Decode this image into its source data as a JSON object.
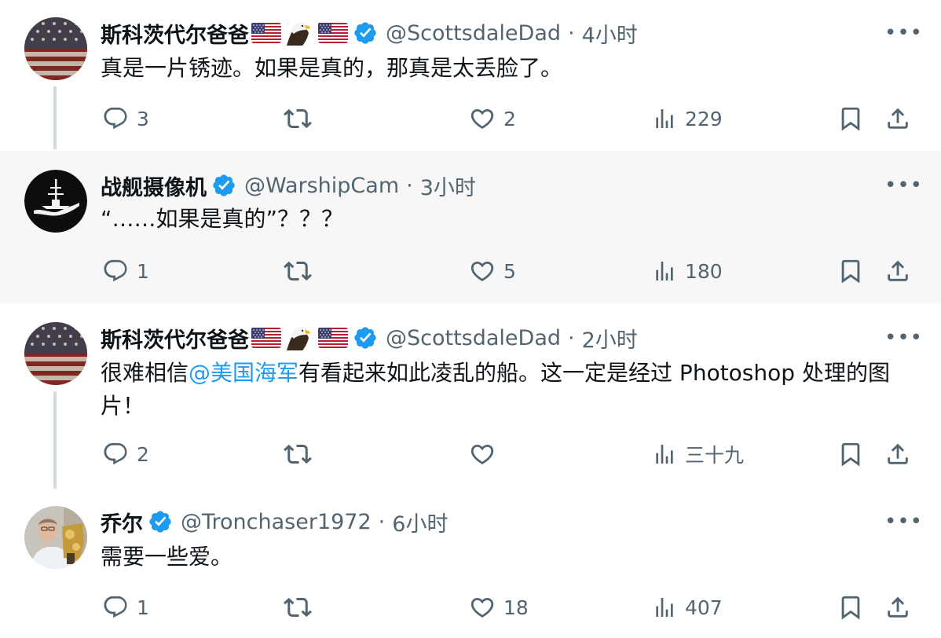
{
  "tweets": [
    {
      "name": "斯科茨代尔爸爸",
      "handle": "@ScottsdaleDad",
      "separator": "·",
      "time": "4小时",
      "text": "真是一片锈迹。如果是真的，那真是太丢脸了。",
      "replies": "3",
      "retweets": "",
      "likes": "2",
      "views": "229"
    },
    {
      "name": "战舰摄像机",
      "handle": "@WarshipCam",
      "separator": "·",
      "time": "3小时",
      "text": "“……如果是真的”？？？",
      "replies": "1",
      "retweets": "",
      "likes": "5",
      "views": "180"
    },
    {
      "name": "斯科茨代尔爸爸",
      "handle": "@ScottsdaleDad",
      "separator": "·",
      "time": "2小时",
      "text_before": "很难相信",
      "mention": "@美国海军",
      "text_after": "有看起来如此凌乱的船。这一定是经过 Photoshop 处理的图片！",
      "replies": "2",
      "retweets": "",
      "likes": "",
      "views": "三十九"
    },
    {
      "name": "乔尔",
      "handle": "@Tronchaser1972",
      "separator": "·",
      "time": "6小时",
      "text": "需要一些爱。",
      "replies": "1",
      "retweets": "",
      "likes": "18",
      "views": "407"
    }
  ],
  "icons": {
    "more": "more-horizontal-icon",
    "reply": "reply-bubble-icon",
    "retweet": "retweet-icon",
    "like": "heart-icon",
    "views": "views-bar-chart-icon",
    "bookmark": "bookmark-icon",
    "share": "share-upload-icon",
    "verified": "verified-badge-icon",
    "flag": "us-flag-icon",
    "eagle": "bald-eagle-icon"
  },
  "colors": {
    "text": "#0f1419",
    "secondary": "#536471",
    "accent": "#1d9bf0",
    "thread_line": "#cfd9de",
    "highlight_bg": "#f7f7f7"
  }
}
